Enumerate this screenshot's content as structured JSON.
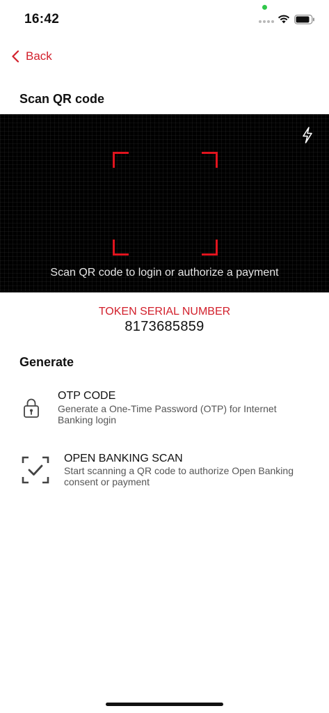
{
  "status_bar": {
    "time": "16:42"
  },
  "nav": {
    "back_label": "Back"
  },
  "page": {
    "title": "Scan QR code"
  },
  "scanner": {
    "hint": "Scan QR code to login or authorize a payment",
    "flash_icon": "lightning-icon"
  },
  "token": {
    "label": "TOKEN SERIAL NUMBER",
    "value": "8173685859"
  },
  "generate": {
    "title": "Generate",
    "options": [
      {
        "title": "OTP CODE",
        "description": "Generate a One-Time Password (OTP) for Internet Banking login",
        "icon": "lock-icon"
      },
      {
        "title": "OPEN BANKING SCAN",
        "description": "Start scanning a QR code to authorize Open Banking consent or payment",
        "icon": "scan-check-icon"
      }
    ]
  },
  "colors": {
    "accent": "#d21f2b",
    "scanner_frame": "#e0141e",
    "scanner_bg": "#000000"
  }
}
